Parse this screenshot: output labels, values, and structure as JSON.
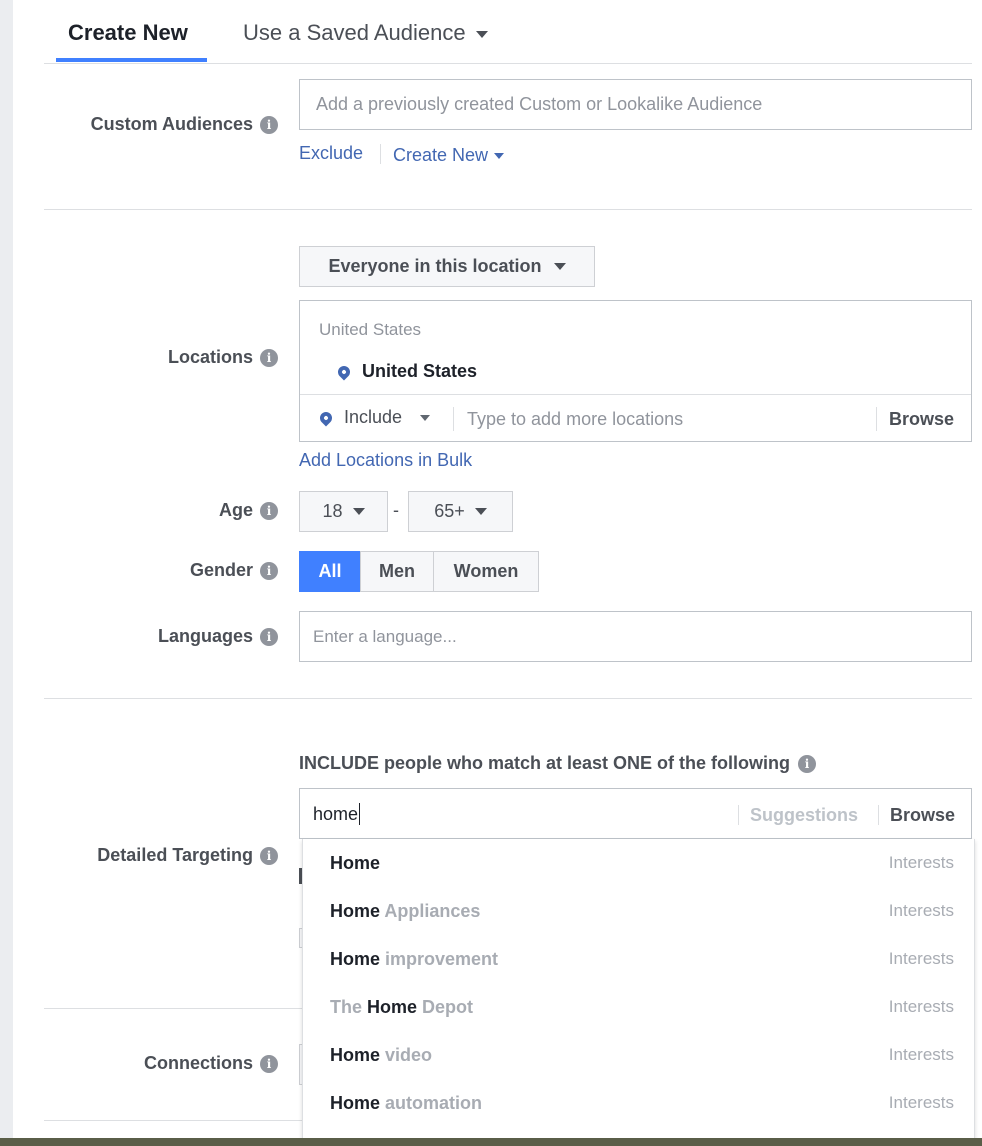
{
  "tabs": {
    "create_new": "Create New",
    "saved_audience": "Use a Saved Audience"
  },
  "custom_audiences": {
    "label": "Custom Audiences",
    "placeholder": "Add a previously created Custom or Lookalike Audience",
    "exclude_link": "Exclude",
    "create_new_link": "Create New"
  },
  "locations": {
    "label": "Locations",
    "scope_dropdown": "Everyone in this location",
    "group_header": "United States",
    "selected": "United States",
    "include_mode": "Include",
    "input_placeholder": "Type to add more locations",
    "browse": "Browse",
    "bulk_link": "Add Locations in Bulk"
  },
  "age": {
    "label": "Age",
    "min": "18",
    "separator": "-",
    "max": "65+"
  },
  "gender": {
    "label": "Gender",
    "options": [
      "All",
      "Men",
      "Women"
    ],
    "selected": "All"
  },
  "languages": {
    "label": "Languages",
    "placeholder": "Enter a language..."
  },
  "detailed_targeting": {
    "label": "Detailed Targeting",
    "include_heading": "INCLUDE people who match at least ONE of the following",
    "search_value": "home",
    "suggestions": "Suggestions",
    "browse": "Browse",
    "results": [
      {
        "match": "Home",
        "rest": "",
        "category": "Interests"
      },
      {
        "match": "Home",
        "rest": " Appliances",
        "category": "Interests"
      },
      {
        "match": "Home",
        "rest": " improvement",
        "category": "Interests"
      },
      {
        "prefix": "The ",
        "match": "Home",
        "rest": " Depot",
        "category": "Interests"
      },
      {
        "match": "Home",
        "rest": " video",
        "category": "Interests"
      },
      {
        "match": "Home",
        "rest": " automation",
        "category": "Interests"
      }
    ]
  },
  "connections": {
    "label": "Connections"
  },
  "colors": {
    "accent": "#4080ff",
    "link": "#4267b2",
    "label_text": "#4b4f56",
    "muted_text": "#90949c"
  }
}
